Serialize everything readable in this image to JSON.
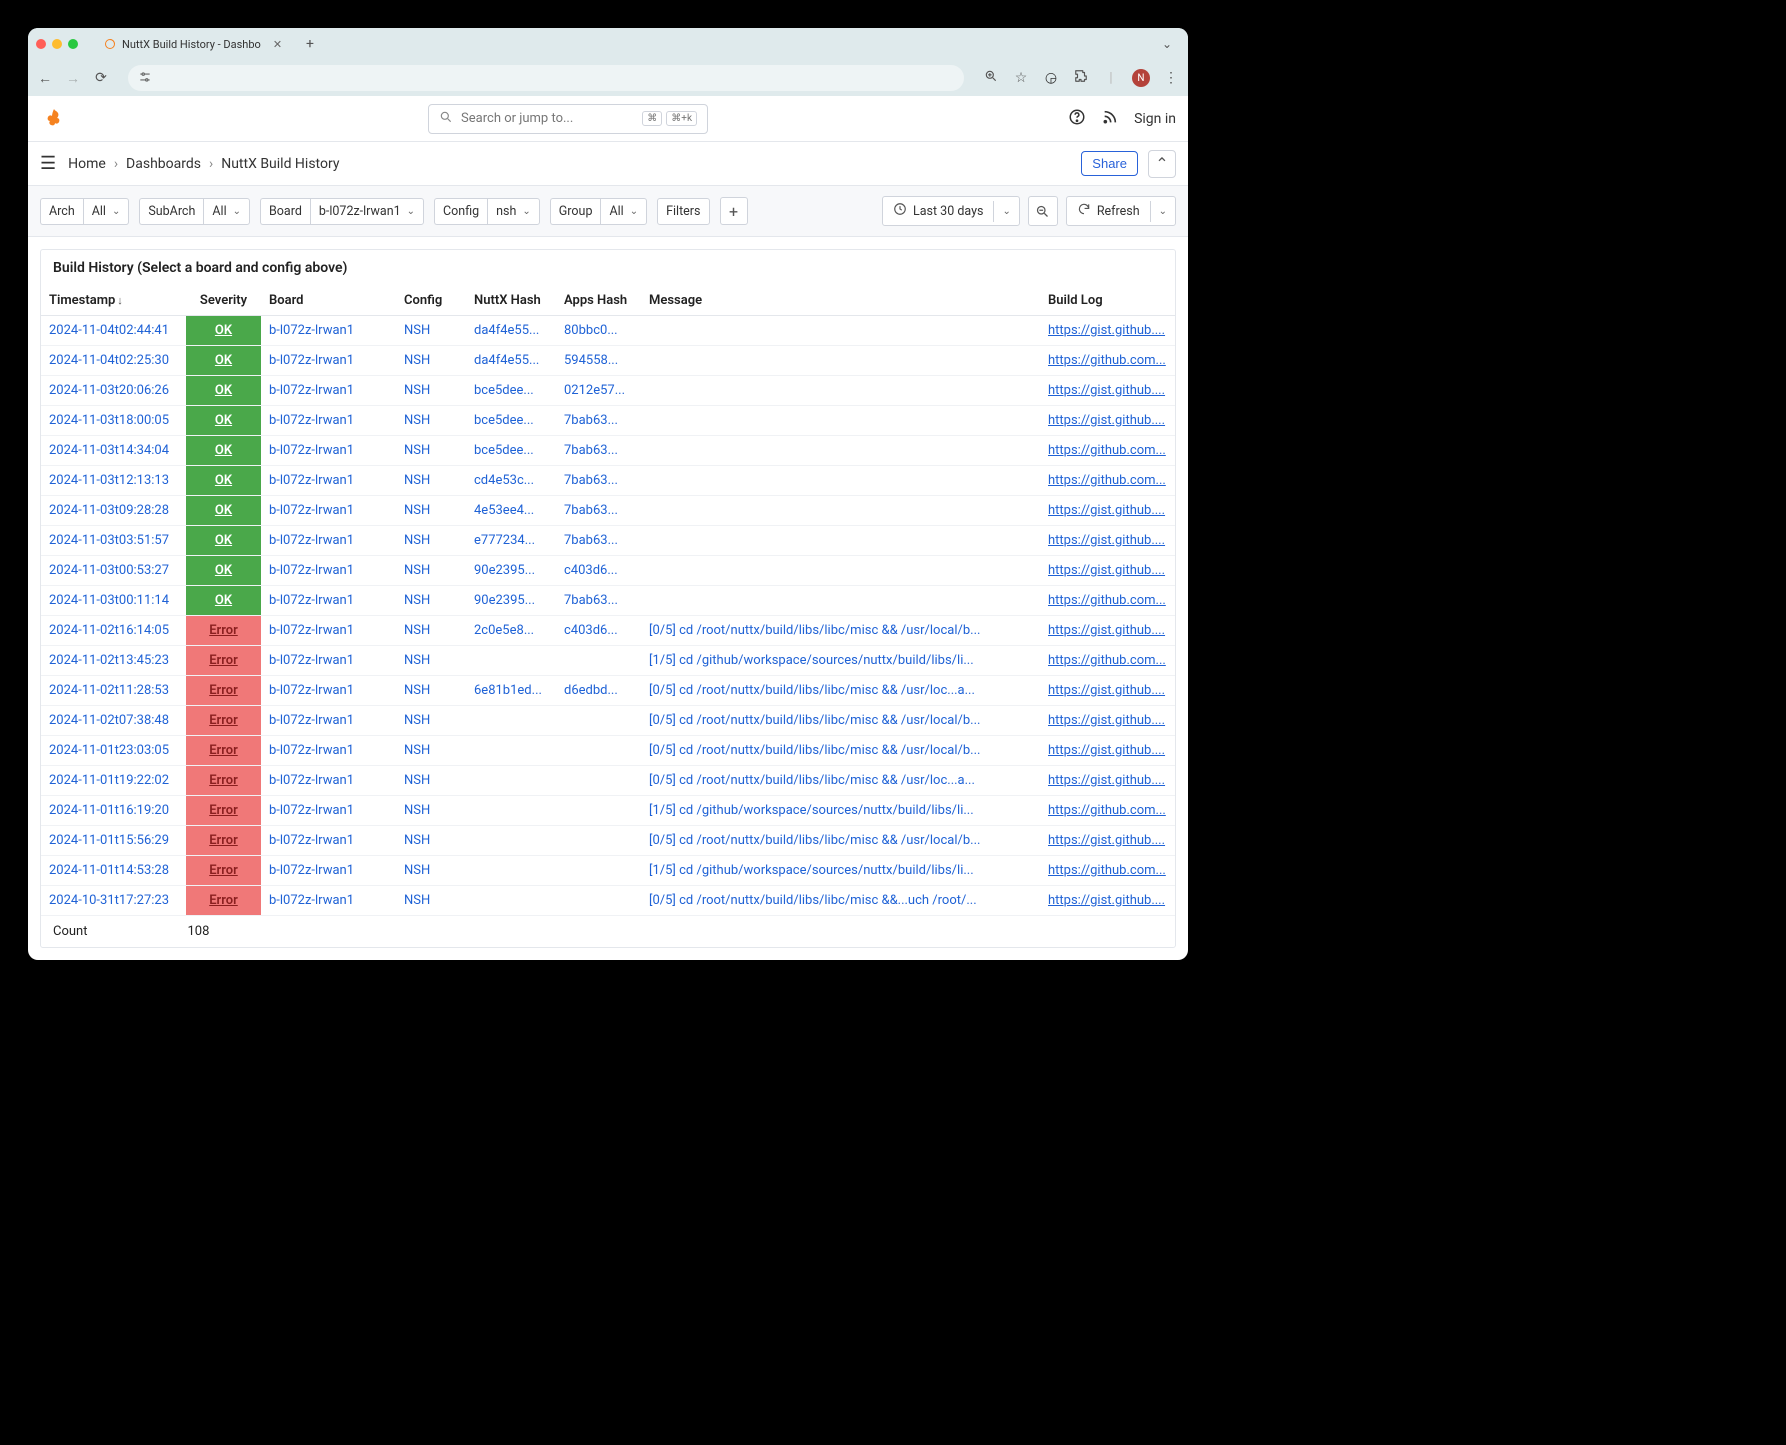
{
  "browser": {
    "tab_title": "NuttX Build History - Dashbo",
    "avatar_letter": "N"
  },
  "header": {
    "search_placeholder": "Search or jump to...",
    "kbd1": "⌘",
    "kbd2": "⌘+k",
    "signin": "Sign in"
  },
  "breadcrumb": {
    "home": "Home",
    "dashboards": "Dashboards",
    "current": "NuttX Build History",
    "share": "Share"
  },
  "vars": {
    "arch_label": "Arch",
    "arch_value": "All",
    "subarch_label": "SubArch",
    "subarch_value": "All",
    "board_label": "Board",
    "board_value": "b-l072z-lrwan1",
    "config_label": "Config",
    "config_value": "nsh",
    "group_label": "Group",
    "group_value": "All",
    "filters_label": "Filters",
    "timerange": "Last 30 days",
    "refresh": "Refresh"
  },
  "panel": {
    "title": "Build History (Select a board and config above)",
    "columns": [
      "Timestamp",
      "Severity",
      "Board",
      "Config",
      "NuttX Hash",
      "Apps Hash",
      "Message",
      "Build Log"
    ],
    "footer_label": "Count",
    "footer_value": "108"
  },
  "rows": [
    {
      "ts": "2024-11-04t02:44:41",
      "sev": "OK",
      "sevc": "ok",
      "board": "b-l072z-lrwan1",
      "cfg": "NSH",
      "nh": "da4f4e55...",
      "ah": "80bbc0...",
      "msg": "",
      "log": "https://gist.github...."
    },
    {
      "ts": "2024-11-04t02:25:30",
      "sev": "OK",
      "sevc": "ok",
      "board": "b-l072z-lrwan1",
      "cfg": "NSH",
      "nh": "da4f4e55...",
      "ah": "594558...",
      "msg": "",
      "log": "https://github.com..."
    },
    {
      "ts": "2024-11-03t20:06:26",
      "sev": "OK",
      "sevc": "ok",
      "board": "b-l072z-lrwan1",
      "cfg": "NSH",
      "nh": "bce5dee...",
      "ah": "0212e57...",
      "msg": "",
      "log": "https://gist.github...."
    },
    {
      "ts": "2024-11-03t18:00:05",
      "sev": "OK",
      "sevc": "ok",
      "board": "b-l072z-lrwan1",
      "cfg": "NSH",
      "nh": "bce5dee...",
      "ah": "7bab63...",
      "msg": "",
      "log": "https://gist.github...."
    },
    {
      "ts": "2024-11-03t14:34:04",
      "sev": "OK",
      "sevc": "ok",
      "board": "b-l072z-lrwan1",
      "cfg": "NSH",
      "nh": "bce5dee...",
      "ah": "7bab63...",
      "msg": "",
      "log": "https://github.com..."
    },
    {
      "ts": "2024-11-03t12:13:13",
      "sev": "OK",
      "sevc": "ok",
      "board": "b-l072z-lrwan1",
      "cfg": "NSH",
      "nh": "cd4e53c...",
      "ah": "7bab63...",
      "msg": "",
      "log": "https://github.com..."
    },
    {
      "ts": "2024-11-03t09:28:28",
      "sev": "OK",
      "sevc": "ok",
      "board": "b-l072z-lrwan1",
      "cfg": "NSH",
      "nh": "4e53ee4...",
      "ah": "7bab63...",
      "msg": "",
      "log": "https://gist.github...."
    },
    {
      "ts": "2024-11-03t03:51:57",
      "sev": "OK",
      "sevc": "ok",
      "board": "b-l072z-lrwan1",
      "cfg": "NSH",
      "nh": "e777234...",
      "ah": "7bab63...",
      "msg": "",
      "log": "https://gist.github...."
    },
    {
      "ts": "2024-11-03t00:53:27",
      "sev": "OK",
      "sevc": "ok",
      "board": "b-l072z-lrwan1",
      "cfg": "NSH",
      "nh": "90e2395...",
      "ah": "c403d6...",
      "msg": "",
      "log": "https://gist.github...."
    },
    {
      "ts": "2024-11-03t00:11:14",
      "sev": "OK",
      "sevc": "ok",
      "board": "b-l072z-lrwan1",
      "cfg": "NSH",
      "nh": "90e2395...",
      "ah": "7bab63...",
      "msg": "",
      "log": "https://github.com..."
    },
    {
      "ts": "2024-11-02t16:14:05",
      "sev": "Error",
      "sevc": "err",
      "board": "b-l072z-lrwan1",
      "cfg": "NSH",
      "nh": "2c0e5e8...",
      "ah": "c403d6...",
      "msg": "[0/5] cd /root/nuttx/build/libs/libc/misc && /usr/local/b...",
      "log": "https://gist.github...."
    },
    {
      "ts": "2024-11-02t13:45:23",
      "sev": "Error",
      "sevc": "err",
      "board": "b-l072z-lrwan1",
      "cfg": "NSH",
      "nh": "",
      "ah": "",
      "msg": "[1/5] cd /github/workspace/sources/nuttx/build/libs/li...",
      "log": "https://github.com..."
    },
    {
      "ts": "2024-11-02t11:28:53",
      "sev": "Error",
      "sevc": "err",
      "board": "b-l072z-lrwan1",
      "cfg": "NSH",
      "nh": "6e81b1ed...",
      "ah": "d6edbd...",
      "msg": "[0/5] cd /root/nuttx/build/libs/libc/misc && /usr/loc...a...",
      "log": "https://gist.github...."
    },
    {
      "ts": "2024-11-02t07:38:48",
      "sev": "Error",
      "sevc": "err",
      "board": "b-l072z-lrwan1",
      "cfg": "NSH",
      "nh": "",
      "ah": "",
      "msg": "[0/5] cd /root/nuttx/build/libs/libc/misc && /usr/local/b...",
      "log": "https://gist.github...."
    },
    {
      "ts": "2024-11-01t23:03:05",
      "sev": "Error",
      "sevc": "err",
      "board": "b-l072z-lrwan1",
      "cfg": "NSH",
      "nh": "",
      "ah": "",
      "msg": "[0/5] cd /root/nuttx/build/libs/libc/misc && /usr/local/b...",
      "log": "https://gist.github...."
    },
    {
      "ts": "2024-11-01t19:22:02",
      "sev": "Error",
      "sevc": "err",
      "board": "b-l072z-lrwan1",
      "cfg": "NSH",
      "nh": "",
      "ah": "",
      "msg": "[0/5] cd /root/nuttx/build/libs/libc/misc && /usr/loc...a...",
      "log": "https://gist.github...."
    },
    {
      "ts": "2024-11-01t16:19:20",
      "sev": "Error",
      "sevc": "err",
      "board": "b-l072z-lrwan1",
      "cfg": "NSH",
      "nh": "",
      "ah": "",
      "msg": "[1/5] cd /github/workspace/sources/nuttx/build/libs/li...",
      "log": "https://github.com..."
    },
    {
      "ts": "2024-11-01t15:56:29",
      "sev": "Error",
      "sevc": "err",
      "board": "b-l072z-lrwan1",
      "cfg": "NSH",
      "nh": "",
      "ah": "",
      "msg": "[0/5] cd /root/nuttx/build/libs/libc/misc && /usr/local/b...",
      "log": "https://gist.github...."
    },
    {
      "ts": "2024-11-01t14:53:28",
      "sev": "Error",
      "sevc": "err",
      "board": "b-l072z-lrwan1",
      "cfg": "NSH",
      "nh": "",
      "ah": "",
      "msg": "[1/5] cd /github/workspace/sources/nuttx/build/libs/li...",
      "log": "https://github.com..."
    },
    {
      "ts": "2024-10-31t17:27:23",
      "sev": "Error",
      "sevc": "err",
      "board": "b-l072z-lrwan1",
      "cfg": "NSH",
      "nh": "",
      "ah": "",
      "msg": "[0/5] cd /root/nuttx/build/libs/libc/misc &&...uch /root/...",
      "log": "https://gist.github...."
    }
  ]
}
